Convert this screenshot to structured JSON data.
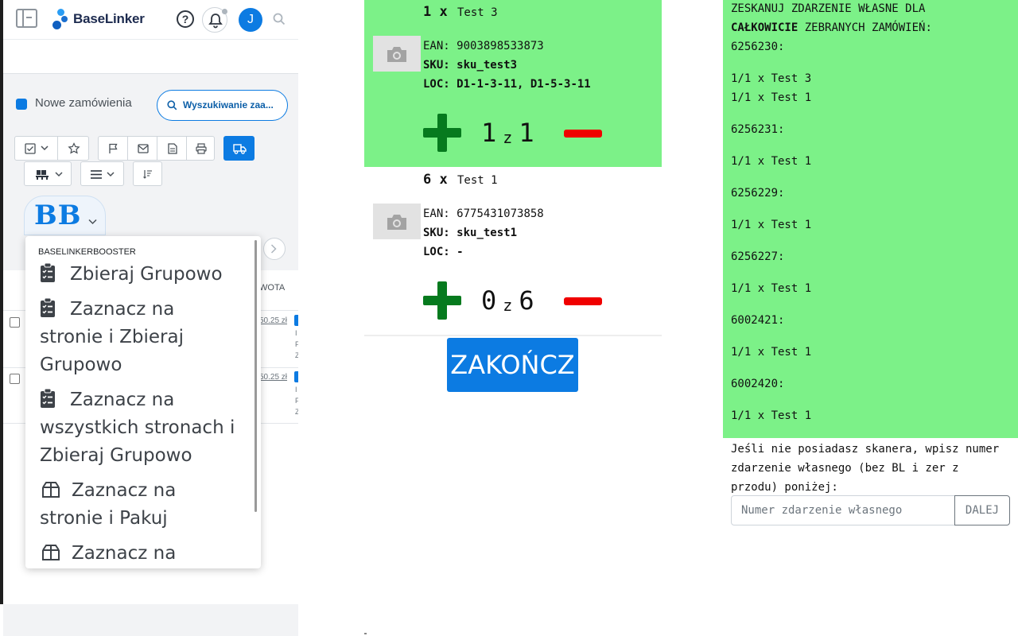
{
  "left": {
    "app_name": "BaseLinker",
    "avatar_initial": "J",
    "filter_label": "Nowe zamówienia",
    "search_orders_label": "Wyszukiwanie zaa...",
    "booster_label": "BB",
    "table_header_amount": "WOTA",
    "rows": [
      {
        "price": "50.25 zł",
        "mini": [
          "I",
          "F",
          "Z"
        ]
      },
      {
        "price": "50.25 zł",
        "mini": [
          "I",
          "F",
          "Z"
        ]
      }
    ],
    "dropdown": {
      "header": "BASELINKERBOOSTER",
      "items": [
        {
          "icon": "clipboard-check-icon",
          "label": "Zbieraj Grupowo"
        },
        {
          "icon": "clipboard-check-icon",
          "label": "Zaznacz na stronie i Zbieraj Grupowo"
        },
        {
          "icon": "clipboard-check-icon",
          "label": "Zaznacz na wszystkich stronach i Zbieraj Grupowo"
        },
        {
          "icon": "box-open-icon",
          "label": "Zaznacz na stronie i Pakuj"
        },
        {
          "icon": "box-open-icon",
          "label": "Zaznacz na"
        }
      ]
    },
    "colors": {
      "accent": "#0c7be2"
    }
  },
  "middle": {
    "products": [
      {
        "qty": "1 x",
        "name": "Test 3",
        "ean_label": "EAN:",
        "ean": "9003898533873",
        "sku_label": "SKU:",
        "sku": "sku_test3",
        "loc_label": "LOC:",
        "loc": "D1-1-3-11, D1-5-3-11",
        "picked": "1",
        "of": "z",
        "total": "1",
        "completed": true
      },
      {
        "qty": "6 x",
        "name": "Test 1",
        "ean_label": "EAN:",
        "ean": "6775431073858",
        "sku_label": "SKU:",
        "sku": "sku_test1",
        "loc_label": "LOC:",
        "loc": "-",
        "picked": "0",
        "of": "z",
        "total": "6",
        "completed": false
      }
    ],
    "finish_label": "ZAKOŃCZ",
    "colors": {
      "completed_bg": "#7cf188",
      "plus": "#067a1e",
      "minus": "#f00000"
    }
  },
  "right": {
    "heading_line1": "ZESKANUJ ZDARZENIE WŁASNE DLA",
    "heading_bold": "CAŁKOWICIE",
    "heading_line2_rest": " ZEBRANYCH ZAMÓWIEŃ:",
    "orders": [
      {
        "id": "6256230:",
        "lines": [
          "1/1 x Test 3",
          "1/1 x Test 1"
        ]
      },
      {
        "id": "6256231:",
        "lines": [
          "1/1 x Test 1"
        ]
      },
      {
        "id": "6256229:",
        "lines": [
          "1/1 x Test 1"
        ]
      },
      {
        "id": "6256227:",
        "lines": [
          "1/1 x Test 1"
        ]
      },
      {
        "id": "6002421:",
        "lines": [
          "1/1 x Test 1"
        ]
      },
      {
        "id": "6002420:",
        "lines": [
          "1/1 x Test 1"
        ]
      }
    ],
    "hint": "Jeśli nie posiadasz skanera, wpisz numer zdarzenie własnego (bez BL i zer z przodu) poniżej:",
    "input_placeholder": "Numer zdarzenie własnego",
    "input_value": "",
    "next_label": "DALEJ"
  }
}
